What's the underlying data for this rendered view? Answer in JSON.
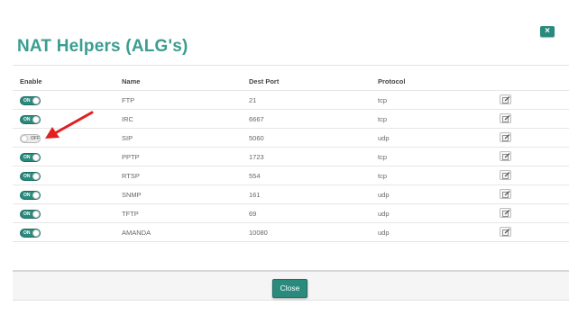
{
  "dialog": {
    "title": "NAT Helpers (ALG's)",
    "close_x_label": "×",
    "close_button_label": "Close"
  },
  "table": {
    "headers": {
      "enable": "Enable",
      "name": "Name",
      "dest_port": "Dest Port",
      "protocol": "Protocol"
    },
    "rows": [
      {
        "enabled": true,
        "toggle_label": "ON",
        "name": "FTP",
        "dest_port": "21",
        "protocol": "tcp"
      },
      {
        "enabled": true,
        "toggle_label": "ON",
        "name": "IRC",
        "dest_port": "6667",
        "protocol": "tcp"
      },
      {
        "enabled": false,
        "toggle_label": "OFF",
        "name": "SIP",
        "dest_port": "5060",
        "protocol": "udp"
      },
      {
        "enabled": true,
        "toggle_label": "ON",
        "name": "PPTP",
        "dest_port": "1723",
        "protocol": "tcp"
      },
      {
        "enabled": true,
        "toggle_label": "ON",
        "name": "RTSP",
        "dest_port": "554",
        "protocol": "tcp"
      },
      {
        "enabled": true,
        "toggle_label": "ON",
        "name": "SNMP",
        "dest_port": "161",
        "protocol": "udp"
      },
      {
        "enabled": true,
        "toggle_label": "ON",
        "name": "TFTP",
        "dest_port": "69",
        "protocol": "udp"
      },
      {
        "enabled": true,
        "toggle_label": "ON",
        "name": "AMANDA",
        "dest_port": "10080",
        "protocol": "udp"
      }
    ]
  },
  "annotation": {
    "icon": "red-arrow-icon",
    "color": "#e02020"
  },
  "colors": {
    "accent": "#2a8a7d",
    "title": "#3a9d8f"
  }
}
